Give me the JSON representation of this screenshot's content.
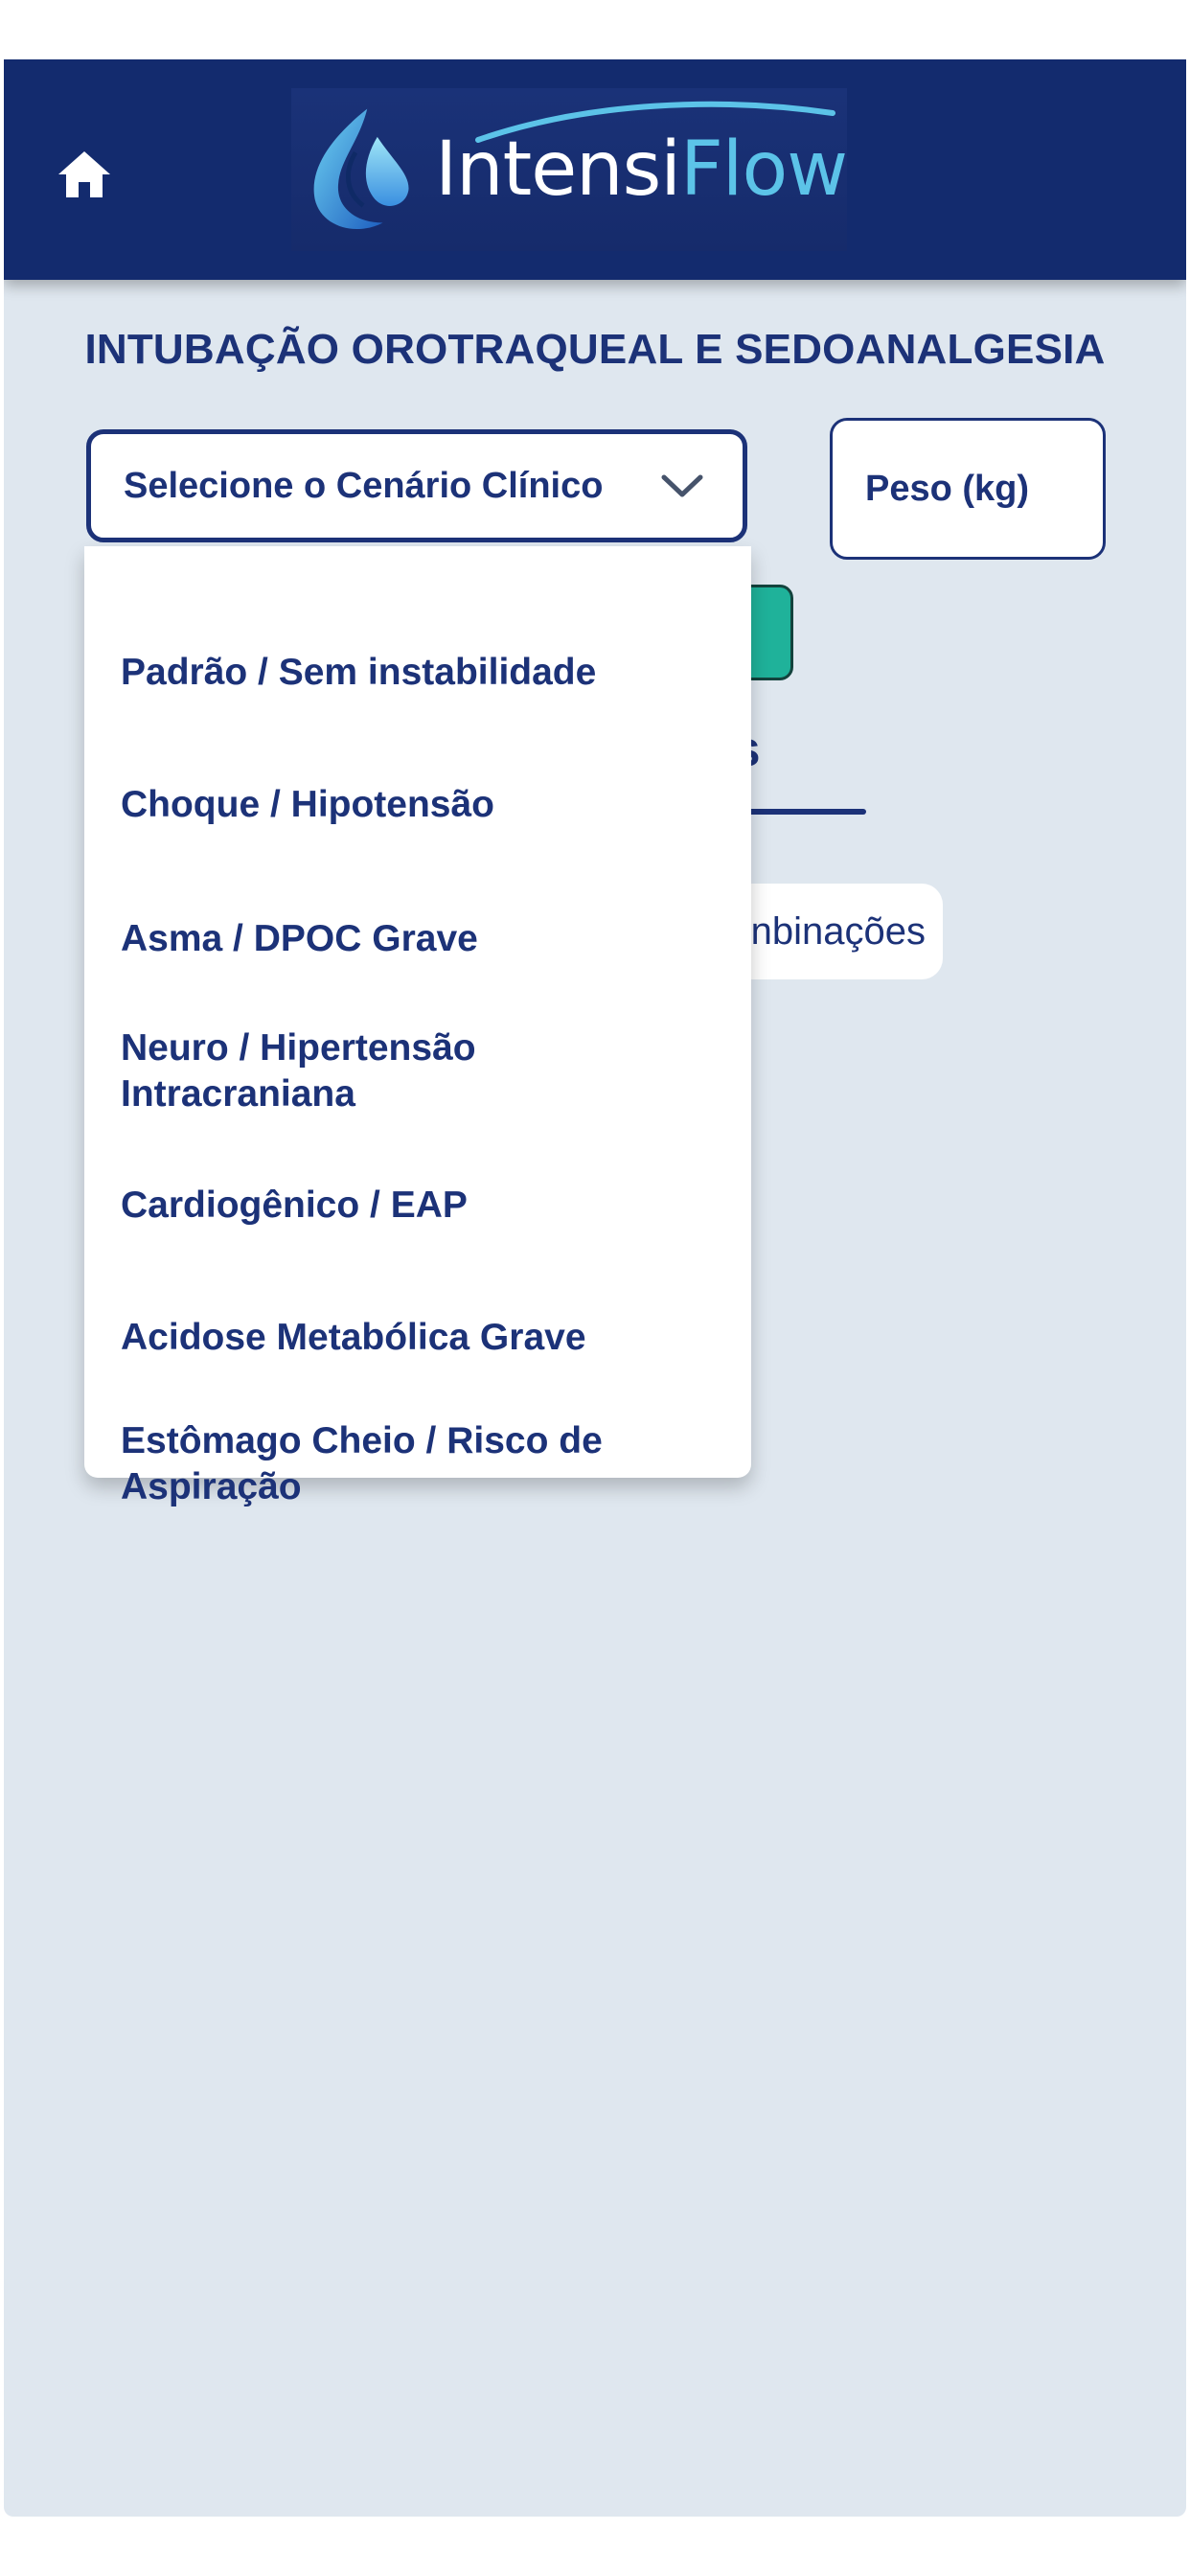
{
  "header": {
    "home_icon": "home-icon",
    "logo_text_prefix": "Intensi",
    "logo_text_suffix": "Flow"
  },
  "page": {
    "title": "INTUBAÇÃO OROTRAQUEAL E SEDOANALGESIA"
  },
  "scenario_select": {
    "label": "Selecione o Cenário Clínico",
    "icon": "chevron-down-icon",
    "options": [
      "Padrão / Sem instabilidade",
      "Choque / Hipotensão",
      "Asma / DPOC Grave",
      "Neuro / Hipertensão Intracraniana",
      "Cardiogênico / EAP",
      "Acidose Metabólica Grave",
      "Estômago Cheio / Risco de Aspiração"
    ]
  },
  "weight": {
    "placeholder": "Peso (kg)"
  },
  "background": {
    "tab_label_partial": "gas",
    "chip_label_partial": "nbinações"
  },
  "colors": {
    "header_bg": "#132b6e",
    "primary_text": "#1c3278",
    "page_bg": "#dfe7ef",
    "accent_teal": "#1fb29a",
    "logo_accent": "#5cc3e8"
  }
}
